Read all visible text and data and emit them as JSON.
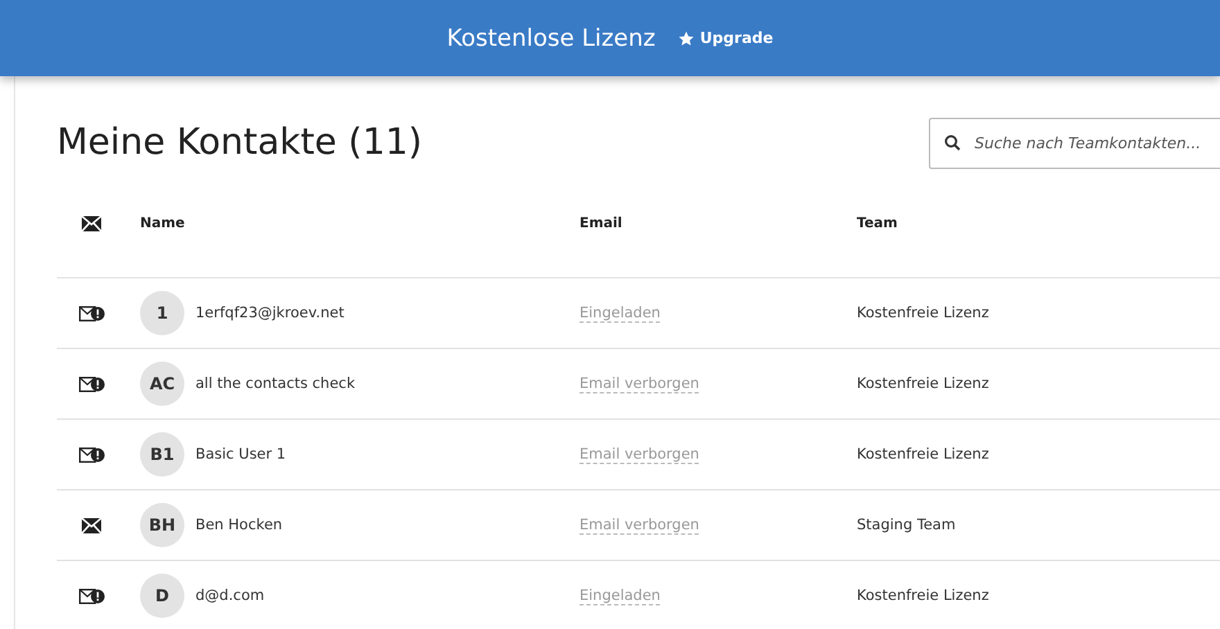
{
  "header": {
    "title": "Kostenlose Lizenz",
    "upgrade": "Upgrade"
  },
  "page": {
    "title": "Meine Kontakte (11)",
    "search": {
      "placeholder": "Suche nach Teamkontakten..."
    }
  },
  "table": {
    "columns": [
      "Name",
      "Email",
      "Team"
    ],
    "rows": [
      {
        "kind": "alert",
        "initials": "1",
        "name": "1erfqf23@jkroev.net",
        "email": "Eingeladen",
        "team": "Kostenfreie Lizenz"
      },
      {
        "kind": "alert",
        "initials": "AC",
        "name": "all the contacts check",
        "email": "Email verborgen",
        "team": "Kostenfreie Lizenz"
      },
      {
        "kind": "alert",
        "initials": "B1",
        "name": "Basic User 1",
        "email": "Email verborgen",
        "team": "Kostenfreie Lizenz"
      },
      {
        "kind": "plain",
        "initials": "BH",
        "name": "Ben Hocken",
        "email": "Email verborgen",
        "team": "Staging Team"
      },
      {
        "kind": "alert",
        "initials": "D",
        "name": "d@d.com",
        "email": "Eingeladen",
        "team": "Kostenfreie Lizenz"
      }
    ]
  }
}
